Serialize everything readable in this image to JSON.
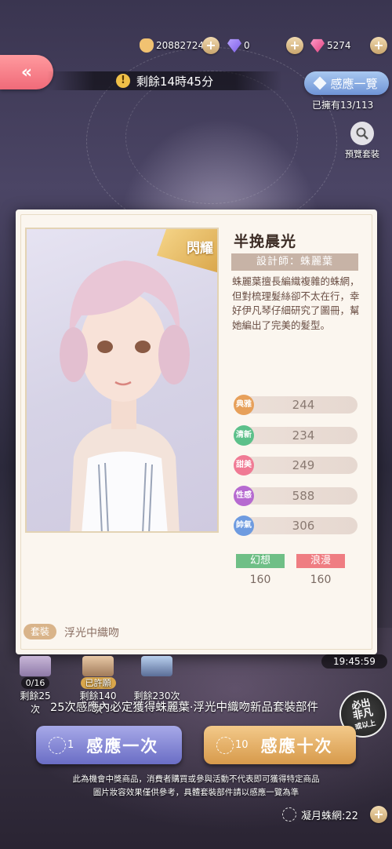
{
  "currencies": [
    {
      "icon": "cat-coin-icon",
      "amount": "20882724"
    },
    {
      "icon": "purple-diamond-icon",
      "amount": "0"
    },
    {
      "icon": "pink-diamond-icon",
      "amount": "5274"
    }
  ],
  "back_label": "«",
  "timer": {
    "text": "剩餘14時45分",
    "icon": "!"
  },
  "induct_button": "感應一覽",
  "owned_text": "已擁有13/113",
  "preview_label": "預覽套裝",
  "card": {
    "ribbon": "閃耀",
    "title": "半挽晨光",
    "designer": "設計師：蛛麗葉",
    "description": "蛛麗葉擅長編織複雜的蛛網，但對梳理髮絲卻不太在行，幸好伊凡琴仔細研究了圖冊，幫她編出了完美的髮型。",
    "stats": [
      {
        "label": "典雅",
        "value": "244",
        "color": "#e7a05a"
      },
      {
        "label": "清新",
        "value": "234",
        "color": "#5cc08a"
      },
      {
        "label": "甜美",
        "value": "249",
        "color": "#f07a94"
      },
      {
        "label": "性感",
        "value": "588",
        "color": "#b66ad0"
      },
      {
        "label": "帥氣",
        "value": "306",
        "color": "#6e9be0"
      }
    ],
    "tags": [
      {
        "label": "幻想",
        "value": "160",
        "color": "#6fbf86"
      },
      {
        "label": "浪漫",
        "value": "160",
        "color": "#ef7d82"
      }
    ],
    "suit_tag": "套裝",
    "suit_name": "浮光中織吻"
  },
  "rewards": [
    {
      "pill": "0/16",
      "text": "剩餘25次"
    },
    {
      "pill": "已許願",
      "text": "剩餘140次"
    },
    {
      "pill": "",
      "text": "剩餘230次"
    }
  ],
  "clock": "19:45:59",
  "notice": "25次感應內必定獲得蛛麗葉·浮光中織吻新品套裝部件",
  "must_badge": {
    "line1": "必出",
    "line2": "非凡",
    "line3": "或以上"
  },
  "pull_one": {
    "count": "1",
    "label": "感應一次"
  },
  "pull_ten": {
    "count": "10",
    "label": "感應十次"
  },
  "disclaimer": {
    "line1": "此為機會中獎商品，消費者購買或參與活動不代表即可獲得特定商品",
    "line2": "圖片妝容效果僅供參考，具體套裝部件請以感應一覽為準"
  },
  "wallet": {
    "text": "凝月蛛網:22"
  }
}
